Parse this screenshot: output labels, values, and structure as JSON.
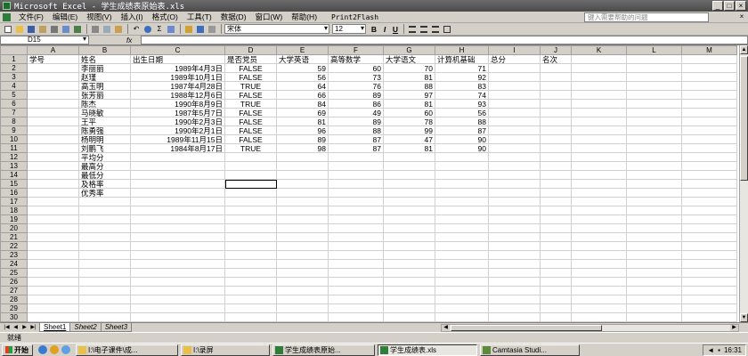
{
  "window": {
    "title": "Microsoft Excel - 学生成绩表原始表.xls",
    "controls": [
      "_",
      "□",
      "×"
    ]
  },
  "menu": {
    "items": [
      "文件(F)",
      "编辑(E)",
      "视图(V)",
      "插入(I)",
      "格式(O)",
      "工具(T)",
      "数据(D)",
      "窗口(W)",
      "帮助(H)",
      "Print2Flash"
    ],
    "help_placeholder": "键入需要帮助的问题"
  },
  "toolbar": {
    "font_name": "宋体",
    "font_size": "12",
    "bold": "B",
    "italic": "I",
    "underline": "U",
    "sum": "Σ",
    "undo": "↶"
  },
  "formula_bar": {
    "name_box": "D15",
    "fx": "fx",
    "formula": ""
  },
  "sheet": {
    "columns": [
      "A",
      "B",
      "C",
      "D",
      "E",
      "F",
      "G",
      "H",
      "I",
      "J",
      "K",
      "L",
      "M"
    ],
    "rows": [
      [
        "学号",
        "姓名",
        "出生日期",
        "是否党员",
        "大学英语",
        "高等数学",
        "大学语文",
        "计算机基础",
        "总分",
        "名次",
        "",
        "",
        ""
      ],
      [
        "",
        "李丽丽",
        "1989年4月3日",
        "FALSE",
        "59",
        "60",
        "70",
        "71",
        "",
        "",
        "",
        "",
        ""
      ],
      [
        "",
        "赵瑾",
        "1989年10月1日",
        "FALSE",
        "56",
        "73",
        "81",
        "92",
        "",
        "",
        "",
        "",
        ""
      ],
      [
        "",
        "高玉明",
        "1987年4月28日",
        "TRUE",
        "64",
        "76",
        "88",
        "83",
        "",
        "",
        "",
        "",
        ""
      ],
      [
        "",
        "张芳丽",
        "1988年12月6日",
        "FALSE",
        "66",
        "89",
        "97",
        "74",
        "",
        "",
        "",
        "",
        ""
      ],
      [
        "",
        "陈杰",
        "1990年8月9日",
        "TRUE",
        "84",
        "86",
        "81",
        "93",
        "",
        "",
        "",
        "",
        ""
      ],
      [
        "",
        "马晓敏",
        "1987年5月7日",
        "FALSE",
        "69",
        "49",
        "60",
        "56",
        "",
        "",
        "",
        "",
        ""
      ],
      [
        "",
        "王平",
        "1990年2月3日",
        "FALSE",
        "81",
        "89",
        "78",
        "88",
        "",
        "",
        "",
        "",
        ""
      ],
      [
        "",
        "陈勇强",
        "1990年2月1日",
        "FALSE",
        "96",
        "88",
        "99",
        "87",
        "",
        "",
        "",
        "",
        ""
      ],
      [
        "",
        "杨明明",
        "1989年11月15日",
        "FALSE",
        "89",
        "87",
        "47",
        "90",
        "",
        "",
        "",
        "",
        ""
      ],
      [
        "",
        "刘鹏飞",
        "1984年8月17日",
        "TRUE",
        "98",
        "87",
        "81",
        "90",
        "",
        "",
        "",
        "",
        ""
      ],
      [
        "",
        "平均分",
        "",
        "",
        "",
        "",
        "",
        "",
        "",
        "",
        "",
        "",
        ""
      ],
      [
        "",
        "最高分",
        "",
        "",
        "",
        "",
        "",
        "",
        "",
        "",
        "",
        "",
        ""
      ],
      [
        "",
        "最低分",
        "",
        "",
        "",
        "",
        "",
        "",
        "",
        "",
        "",
        "",
        ""
      ],
      [
        "",
        "及格率",
        "",
        "",
        "",
        "",
        "",
        "",
        "",
        "",
        "",
        "",
        ""
      ],
      [
        "",
        "优秀率",
        "",
        "",
        "",
        "",
        "",
        "",
        "",
        "",
        "",
        "",
        ""
      ],
      [
        "",
        "",
        "",
        "",
        "",
        "",
        "",
        "",
        "",
        "",
        "",
        "",
        ""
      ],
      [
        "",
        "",
        "",
        "",
        "",
        "",
        "",
        "",
        "",
        "",
        "",
        "",
        ""
      ],
      [
        "",
        "",
        "",
        "",
        "",
        "",
        "",
        "",
        "",
        "",
        "",
        "",
        ""
      ],
      [
        "",
        "",
        "",
        "",
        "",
        "",
        "",
        "",
        "",
        "",
        "",
        "",
        ""
      ],
      [
        "",
        "",
        "",
        "",
        "",
        "",
        "",
        "",
        "",
        "",
        "",
        "",
        ""
      ],
      [
        "",
        "",
        "",
        "",
        "",
        "",
        "",
        "",
        "",
        "",
        "",
        "",
        ""
      ],
      [
        "",
        "",
        "",
        "",
        "",
        "",
        "",
        "",
        "",
        "",
        "",
        "",
        ""
      ],
      [
        "",
        "",
        "",
        "",
        "",
        "",
        "",
        "",
        "",
        "",
        "",
        "",
        ""
      ],
      [
        "",
        "",
        "",
        "",
        "",
        "",
        "",
        "",
        "",
        "",
        "",
        "",
        ""
      ],
      [
        "",
        "",
        "",
        "",
        "",
        "",
        "",
        "",
        "",
        "",
        "",
        "",
        ""
      ],
      [
        "",
        "",
        "",
        "",
        "",
        "",
        "",
        "",
        "",
        "",
        "",
        "",
        ""
      ],
      [
        "",
        "",
        "",
        "",
        "",
        "",
        "",
        "",
        "",
        "",
        "",
        "",
        ""
      ],
      [
        "",
        "",
        "",
        "",
        "",
        "",
        "",
        "",
        "",
        "",
        "",
        "",
        ""
      ],
      [
        "",
        "",
        "",
        "",
        "",
        "",
        "",
        "",
        "",
        "",
        "",
        "",
        ""
      ],
      [
        "",
        "",
        "",
        "",
        "",
        "",
        "",
        "",
        "",
        "",
        "",
        "",
        ""
      ]
    ],
    "tabs": [
      "Sheet1",
      "Sheet2",
      "Sheet3"
    ],
    "active_tab": "Sheet1"
  },
  "status": {
    "text": "就绪"
  },
  "taskbar": {
    "start": "开始",
    "tasks": [
      "I:\\电子课件\\成...",
      "I:\\录屏",
      "学生成绩表原始...",
      "学生成绩表.xls",
      "Camtasia Studi..."
    ],
    "active_task": 3,
    "clock": "16:31"
  },
  "colors": {
    "title_bar": "#555555",
    "chrome": "#d4d0c8",
    "grid_line": "#d0d0d0"
  }
}
